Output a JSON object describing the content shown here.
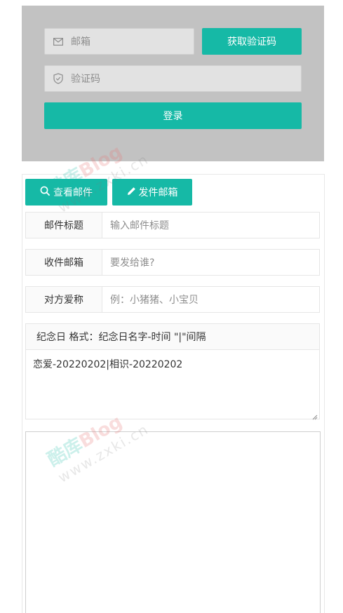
{
  "login": {
    "email_placeholder": "邮箱",
    "get_code_label": "获取验证码",
    "code_placeholder": "验证码",
    "login_label": "登录"
  },
  "tabs": {
    "view_label": "查看邮件",
    "send_label": "发件邮箱"
  },
  "form": {
    "subject_label": "邮件标题",
    "subject_placeholder": "输入邮件标题",
    "recipient_label": "收件邮箱",
    "recipient_placeholder": "要发给谁?",
    "nickname_label": "对方爱称",
    "nickname_placeholder": "例：小猪猪、小宝贝",
    "memorial_label": "纪念日 格式：纪念日名字-时间 \"|\"间隔",
    "memorial_value": "恋爱-20220202|相识-20220202"
  },
  "watermark": {
    "cn": "酷库",
    "blog": "Blog",
    "url": "www.zxki.cn"
  },
  "colors": {
    "accent": "#16b9a6",
    "login_bg": "#c2c2c2"
  }
}
